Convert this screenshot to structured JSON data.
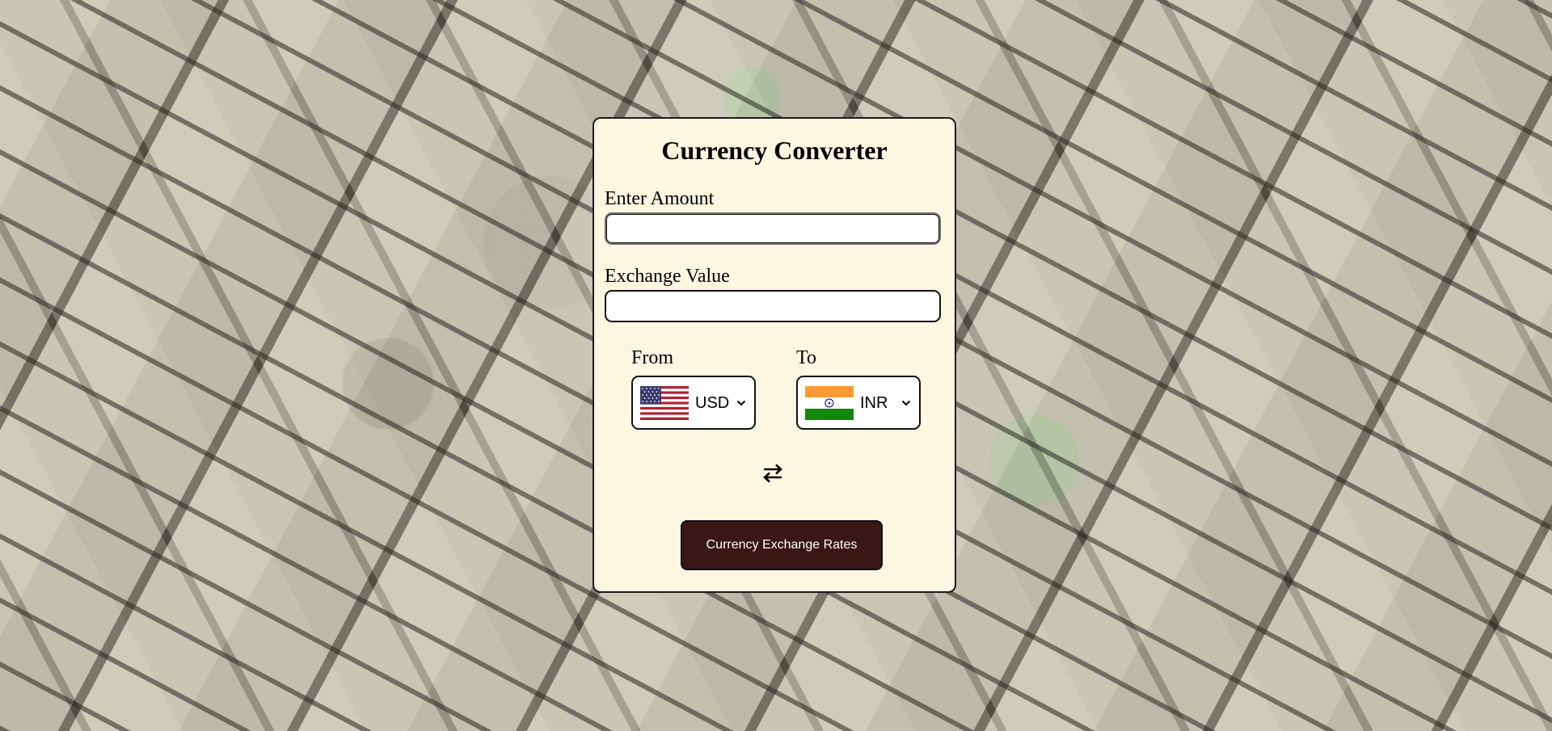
{
  "page": {
    "background": "scattered-dollar-bills-image"
  },
  "converter": {
    "title": "Currency Converter",
    "amount": {
      "label": "Enter Amount",
      "value": "",
      "placeholder": ""
    },
    "exchange": {
      "label": "Exchange Value",
      "value": "",
      "placeholder": ""
    },
    "from": {
      "label": "From",
      "selected": "USD",
      "flag_icon": "us-flag-icon"
    },
    "to": {
      "label": "To",
      "selected": "INR",
      "flag_icon": "india-flag-icon"
    },
    "swap_icon": "swap-arrows-icon",
    "button_label": "Currency Exchange Rates",
    "colors": {
      "card_background": "#fcf7e1",
      "button_background": "#3a1616",
      "button_text": "#ffffff",
      "border": "#111111"
    }
  }
}
